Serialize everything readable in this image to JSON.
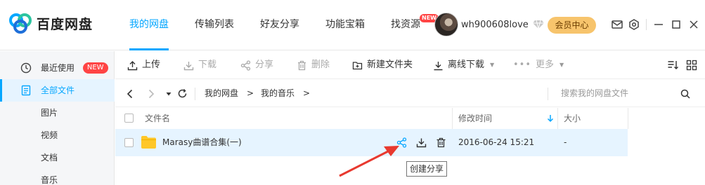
{
  "app": {
    "name": "百度网盘"
  },
  "nav": {
    "items": [
      {
        "label": "我的网盘"
      },
      {
        "label": "传输列表"
      },
      {
        "label": "好友分享"
      },
      {
        "label": "功能宝箱"
      },
      {
        "label": "找资源"
      }
    ],
    "new_sup": "NEW"
  },
  "user": {
    "name": "wh900608love",
    "vip_label": "会员中心"
  },
  "sidebar": {
    "items": [
      {
        "label": "最近使用",
        "badge": "NEW"
      },
      {
        "label": "全部文件"
      },
      {
        "label": "图片"
      },
      {
        "label": "视频"
      },
      {
        "label": "文档"
      },
      {
        "label": "音乐"
      }
    ]
  },
  "toolbar": {
    "upload": "上传",
    "download": "下载",
    "share": "分享",
    "delete": "删除",
    "new_folder": "新建文件夹",
    "offline_download": "离线下载",
    "more": "更多"
  },
  "path": {
    "crumbs": [
      "我的网盘",
      ">",
      "我的音乐",
      ">"
    ],
    "search_placeholder": "搜索我的网盘文件"
  },
  "table": {
    "headers": {
      "name": "文件名",
      "modified": "修改时间",
      "size": "大小"
    },
    "rows": [
      {
        "name": "Marasy曲谱合集(一)",
        "modified": "2016-06-24 15:21",
        "size": "-"
      }
    ]
  },
  "tooltip": "创建分享",
  "colors": {
    "accent": "#06a7ff",
    "vip": "#f7c46c",
    "badge": "#ff4444",
    "arrow": "#e8392f"
  }
}
